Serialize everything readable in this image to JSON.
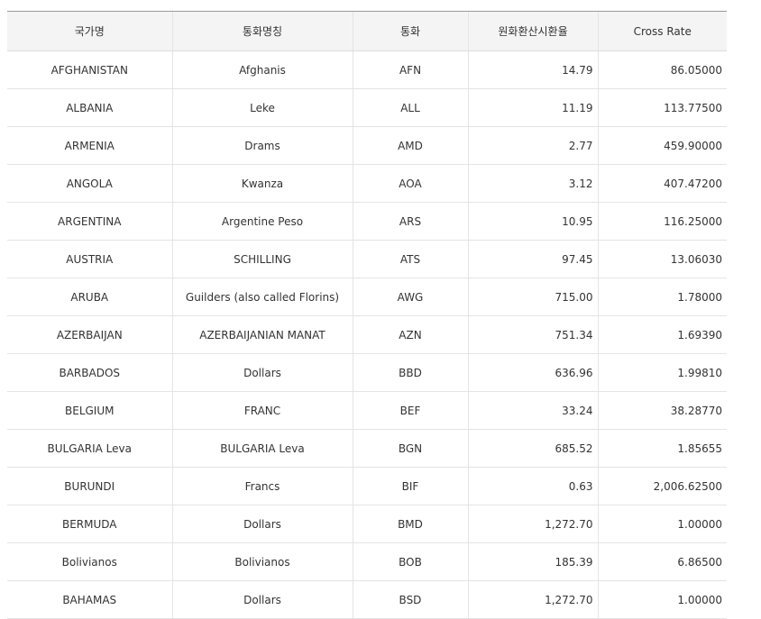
{
  "table": {
    "headers": {
      "country": "국가명",
      "currency_name": "통화명칭",
      "currency_code": "통화",
      "krw_rate": "원화환산시환율",
      "cross_rate": "Cross Rate"
    },
    "rows": [
      {
        "country": "AFGHANISTAN",
        "currency_name": "Afghanis",
        "currency_code": "AFN",
        "krw_rate": "14.79",
        "cross_rate": "86.05000"
      },
      {
        "country": "ALBANIA",
        "currency_name": "Leke",
        "currency_code": "ALL",
        "krw_rate": "11.19",
        "cross_rate": "113.77500"
      },
      {
        "country": "ARMENIA",
        "currency_name": "Drams",
        "currency_code": "AMD",
        "krw_rate": "2.77",
        "cross_rate": "459.90000"
      },
      {
        "country": "ANGOLA",
        "currency_name": "Kwanza",
        "currency_code": "AOA",
        "krw_rate": "3.12",
        "cross_rate": "407.47200"
      },
      {
        "country": "ARGENTINA",
        "currency_name": "Argentine Peso",
        "currency_code": "ARS",
        "krw_rate": "10.95",
        "cross_rate": "116.25000"
      },
      {
        "country": "AUSTRIA",
        "currency_name": "SCHILLING",
        "currency_code": "ATS",
        "krw_rate": "97.45",
        "cross_rate": "13.06030"
      },
      {
        "country": "ARUBA",
        "currency_name": "Guilders (also called Florins)",
        "currency_code": "AWG",
        "krw_rate": "715.00",
        "cross_rate": "1.78000"
      },
      {
        "country": "AZERBAIJAN",
        "currency_name": "AZERBAIJANIAN MANAT",
        "currency_code": "AZN",
        "krw_rate": "751.34",
        "cross_rate": "1.69390"
      },
      {
        "country": "BARBADOS",
        "currency_name": "Dollars",
        "currency_code": "BBD",
        "krw_rate": "636.96",
        "cross_rate": "1.99810"
      },
      {
        "country": "BELGIUM",
        "currency_name": "FRANC",
        "currency_code": "BEF",
        "krw_rate": "33.24",
        "cross_rate": "38.28770"
      },
      {
        "country": "BULGARIA Leva",
        "currency_name": "BULGARIA Leva",
        "currency_code": "BGN",
        "krw_rate": "685.52",
        "cross_rate": "1.85655"
      },
      {
        "country": "BURUNDI",
        "currency_name": "Francs",
        "currency_code": "BIF",
        "krw_rate": "0.63",
        "cross_rate": "2,006.62500"
      },
      {
        "country": "BERMUDA",
        "currency_name": "Dollars",
        "currency_code": "BMD",
        "krw_rate": "1,272.70",
        "cross_rate": "1.00000"
      },
      {
        "country": "Bolivianos",
        "currency_name": "Bolivianos",
        "currency_code": "BOB",
        "krw_rate": "185.39",
        "cross_rate": "6.86500"
      },
      {
        "country": "BAHAMAS",
        "currency_name": "Dollars",
        "currency_code": "BSD",
        "krw_rate": "1,272.70",
        "cross_rate": "1.00000"
      }
    ]
  }
}
